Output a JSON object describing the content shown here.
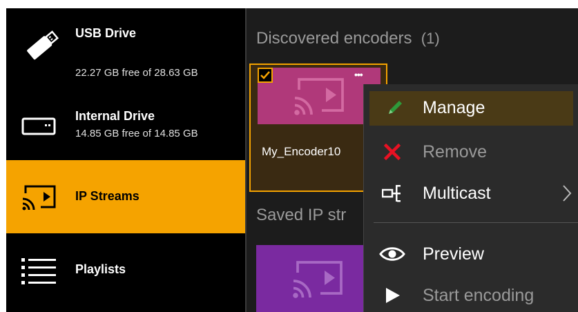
{
  "sidebar": {
    "items": [
      {
        "id": "usb",
        "title": "USB Drive",
        "subtitle": "22.27 GB free of 28.63 GB"
      },
      {
        "id": "internal",
        "title": "Internal Drive",
        "subtitle": "14.85 GB free of 14.85 GB"
      },
      {
        "id": "ip",
        "title": "IP Streams"
      },
      {
        "id": "playlists",
        "title": "Playlists"
      }
    ]
  },
  "main": {
    "discovered_title": "Discovered encoders",
    "discovered_count": "(1)",
    "encoder_name": "My_Encoder10",
    "more_label": "•••",
    "saved_title": "Saved IP str"
  },
  "menu": {
    "items": [
      {
        "label": "Manage",
        "icon": "pencil-icon"
      },
      {
        "label": "Remove",
        "icon": "close-icon"
      },
      {
        "label": "Multicast",
        "icon": "multicast-icon"
      },
      {
        "label": "Preview",
        "icon": "eye-icon"
      },
      {
        "label": "Start encoding",
        "icon": "play-icon"
      }
    ]
  },
  "colors": {
    "accent": "#f5a300",
    "tile_pink": "#b0397a",
    "tile_purple": "#7a2aa0",
    "remove_red": "#e81123",
    "pencil_green": "#2e9a3a"
  }
}
